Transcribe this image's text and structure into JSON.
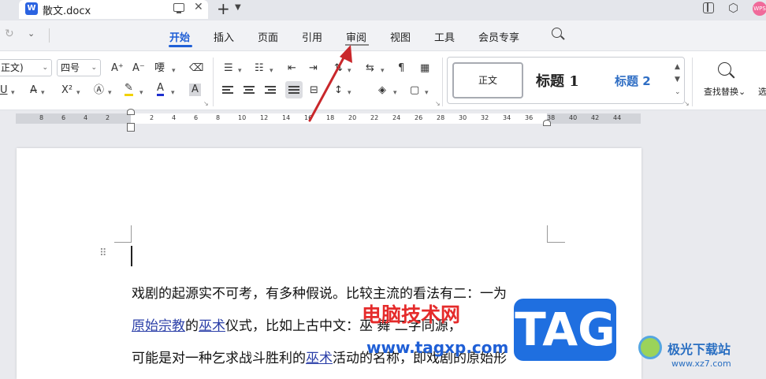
{
  "titlebar": {
    "app_icon": "W",
    "doc_title": "散文.docx",
    "avatar": "WPS"
  },
  "menu": {
    "items": [
      {
        "label": "开始",
        "active": true
      },
      {
        "label": "插入"
      },
      {
        "label": "页面"
      },
      {
        "label": "引用"
      },
      {
        "label": "审阅",
        "highlighted": true
      },
      {
        "label": "视图"
      },
      {
        "label": "工具"
      },
      {
        "label": "会员专享"
      }
    ]
  },
  "ribbon": {
    "font_name": "正文)",
    "font_size": "四号",
    "styles": {
      "normal": "正文",
      "h1": "标题  1",
      "h2": "标题  2"
    },
    "find_replace": "查找替换",
    "more": "选"
  },
  "ruler": {
    "ticks": [
      "8",
      "6",
      "4",
      "2",
      "2",
      "4",
      "6",
      "8",
      "10",
      "12",
      "14",
      "16",
      "18",
      "20",
      "22",
      "24",
      "26",
      "28",
      "30",
      "32",
      "34",
      "36",
      "38",
      "40",
      "42",
      "44"
    ]
  },
  "document": {
    "line1": "戏剧的起源实不可考，有多种假说。比较主流的看法有二：一为",
    "line2_link1": "原始宗教",
    "line2_mid": "的",
    "line2_link2": "巫术",
    "line2_rest": "仪式，比如上古中文：巫 舞 二字同源，",
    "line3_start": "可能是对一种乞求战斗胜利的",
    "line3_link": "巫术",
    "line3_rest": "活动的名称，即戏剧的原始形"
  },
  "watermarks": {
    "site_cn": "电脑技术网",
    "site_url": "www.tagxp.com",
    "badge": "TAG",
    "corner_name": "极光下载站",
    "corner_url": "www.xz7.com"
  },
  "colors": {
    "accent": "#1f5fd6",
    "annotation_arrow": "#c9272b"
  }
}
